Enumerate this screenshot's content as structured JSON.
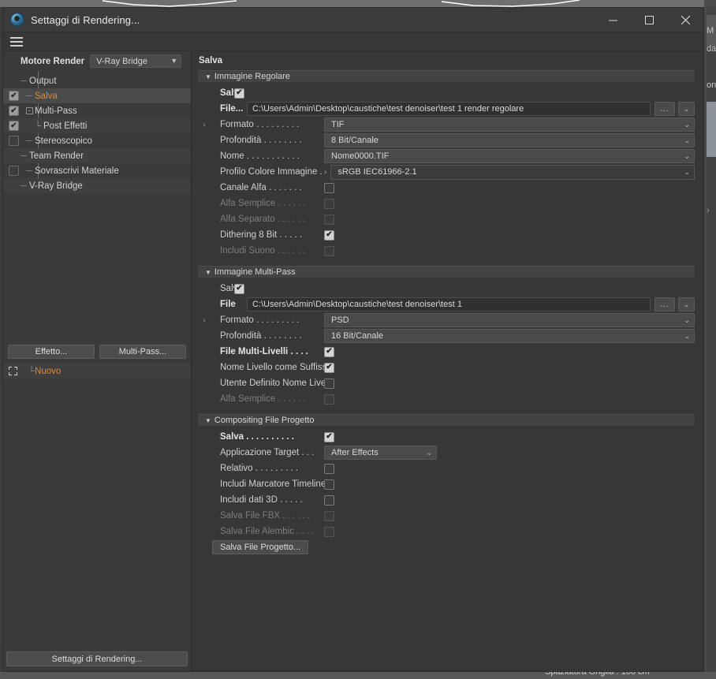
{
  "window": {
    "title": "Settaggi di Rendering...",
    "icon": "cinema4d-app-icon",
    "minimize": "—",
    "maximize": "□",
    "close": "✕"
  },
  "left": {
    "engine_label": "Motore Render",
    "engine_value": "V-Ray Bridge",
    "tree": [
      {
        "label": "Output",
        "checkbox": "none",
        "selected": false,
        "accent": false,
        "indent": "child",
        "twisty": ""
      },
      {
        "label": "Salva",
        "checkbox": "checked",
        "selected": true,
        "accent": true,
        "indent": "child",
        "twisty": ""
      },
      {
        "label": "Multi-Pass",
        "checkbox": "checked",
        "selected": false,
        "accent": false,
        "indent": "child",
        "twisty": "-"
      },
      {
        "label": "Post Effetti",
        "checkbox": "checked",
        "selected": false,
        "accent": false,
        "indent": "grandchild",
        "twisty": ""
      },
      {
        "label": "Stereoscopico",
        "checkbox": "unchecked",
        "selected": false,
        "accent": false,
        "indent": "child",
        "twisty": ""
      },
      {
        "label": "Team Render",
        "checkbox": "none",
        "selected": false,
        "accent": false,
        "indent": "child",
        "twisty": ""
      },
      {
        "label": "Sovrascrivi Materiale",
        "checkbox": "unchecked",
        "selected": false,
        "accent": false,
        "indent": "child",
        "twisty": ""
      },
      {
        "label": "V-Ray Bridge",
        "checkbox": "none",
        "selected": false,
        "accent": false,
        "indent": "child",
        "twisty": ""
      }
    ],
    "effect_button": "Effetto...",
    "multipass_button": "Multi-Pass...",
    "new_item": "Nuovo",
    "footer_button": "Settaggi di Rendering..."
  },
  "right": {
    "header": "Salva",
    "groups": [
      {
        "title": "Immagine Regolare",
        "rows": [
          {
            "kind": "checkbox",
            "label": "Salva",
            "bold": true,
            "shortlabel": true,
            "checked": true,
            "dim": false
          },
          {
            "kind": "file",
            "label": "File...",
            "value": "C:\\Users\\Admin\\Desktop\\caustiche\\test denoiser\\test 1 render regolare",
            "browse": "...",
            "drop": "⌄"
          },
          {
            "kind": "combo",
            "label": "Formato",
            "expand": "›",
            "value": "TIF",
            "dim": false
          },
          {
            "kind": "combo",
            "label": "Profondità",
            "value": "8 Bit/Canale",
            "dim": false
          },
          {
            "kind": "combo",
            "label": "Nome",
            "value": "Nome0000.TIF",
            "dim": false
          },
          {
            "kind": "profile",
            "label": "Profilo Colore Immagine",
            "mark": "›",
            "value": "sRGB IEC61966-2.1",
            "dim": false
          },
          {
            "kind": "checkbox",
            "label": "Canale Alfa",
            "checked": false,
            "dim": false
          },
          {
            "kind": "checkbox",
            "label": "Alfa Semplice",
            "checked": false,
            "dim": true
          },
          {
            "kind": "checkbox",
            "label": "Alfa Separato",
            "checked": false,
            "dim": true
          },
          {
            "kind": "checkbox",
            "label": "Dithering 8 Bit",
            "checked": true,
            "dim": false
          },
          {
            "kind": "checkbox",
            "label": "Includi Suono",
            "checked": false,
            "dim": true
          }
        ]
      },
      {
        "title": "Immagine Multi-Pass",
        "rows": [
          {
            "kind": "checkbox",
            "label": "Salva",
            "shortlabel": true,
            "checked": true,
            "dim": false
          },
          {
            "kind": "file",
            "label": "File",
            "value": "C:\\Users\\Admin\\Desktop\\caustiche\\test denoiser\\test 1",
            "browse": "...",
            "drop": "⌄"
          },
          {
            "kind": "combo",
            "label": "Formato",
            "expand": "›",
            "value": "PSD",
            "dim": false
          },
          {
            "kind": "combo",
            "label": "Profondità",
            "value": "16 Bit/Canale",
            "dim": false
          },
          {
            "kind": "checkbox",
            "label": "File Multi-Livelli",
            "bold": true,
            "checked": true,
            "dim": false
          },
          {
            "kind": "checkbox",
            "label": "Nome Livello come Suffisso",
            "nodots": true,
            "checked": true,
            "dim": false
          },
          {
            "kind": "checkbox",
            "label": "Utente Definito Nome Livello",
            "nodots": true,
            "checked": false,
            "dim": false
          },
          {
            "kind": "checkbox",
            "label": "Alfa Semplice",
            "checked": false,
            "dim": true
          }
        ]
      },
      {
        "title": "Compositing File Progetto",
        "rows": [
          {
            "kind": "checkbox",
            "label": "Salva",
            "bold": true,
            "checked": true,
            "dim": false
          },
          {
            "kind": "combo-fixed",
            "label": "Applicazione Target",
            "value": "After Effects",
            "dim": false
          },
          {
            "kind": "checkbox",
            "label": "Relativo",
            "checked": false,
            "dim": false
          },
          {
            "kind": "checkbox",
            "label": "Includi Marcatore Timeline",
            "nodots": true,
            "checked": false,
            "dim": false
          },
          {
            "kind": "checkbox",
            "label": "Includi dati 3D",
            "checked": false,
            "dim": false
          },
          {
            "kind": "checkbox",
            "label": "Salva File FBX",
            "checked": false,
            "dim": true
          },
          {
            "kind": "checkbox",
            "label": "Salva File Alembic",
            "checked": false,
            "dim": true
          },
          {
            "kind": "button",
            "label": "Salva File Progetto..."
          }
        ]
      }
    ]
  },
  "background": {
    "status_text": "Spaziatura Griglia : 100 cm",
    "edge_fragments": [
      "M",
      "da",
      "on"
    ]
  },
  "colors": {
    "accent": "#d98b3a",
    "panel": "#373737",
    "panel_light": "#434343",
    "field": "#303030",
    "text": "#cfcfcf"
  }
}
